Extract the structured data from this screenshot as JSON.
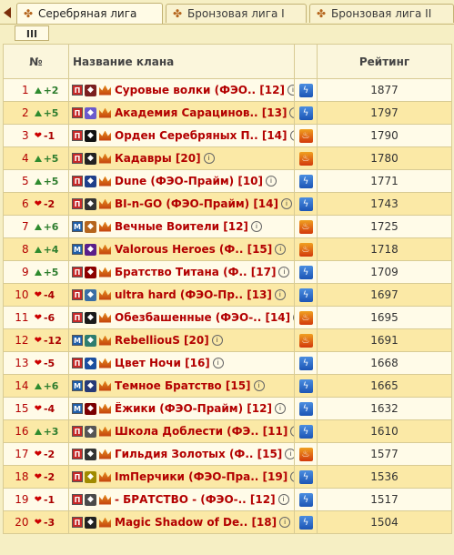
{
  "tabs": [
    {
      "label": "Серебряная лига",
      "active": true
    },
    {
      "label": "Бронзовая лига I",
      "active": false
    },
    {
      "label": "Бронзовая лига II",
      "active": false
    }
  ],
  "subtab": "III",
  "headers": {
    "num": "№",
    "name": "Название клана",
    "rating": "Рейтинг"
  },
  "rows": [
    {
      "rank": "1",
      "change": "+2",
      "dir": "up",
      "align": "П",
      "name": "Суровые волки (ФЭО.. [12]",
      "element": "water",
      "rating": "1877"
    },
    {
      "rank": "2",
      "change": "+5",
      "dir": "up",
      "align": "П",
      "name": "Академия Сарацинов.. [13]",
      "element": "water",
      "rating": "1797"
    },
    {
      "rank": "3",
      "change": "-1",
      "dir": "down",
      "align": "П",
      "name": "Орден Серебряных П.. [14]",
      "element": "fire",
      "rating": "1790"
    },
    {
      "rank": "4",
      "change": "+5",
      "dir": "up",
      "align": "П",
      "name": "Кадавры [20]",
      "element": "fire",
      "rating": "1780"
    },
    {
      "rank": "5",
      "change": "+5",
      "dir": "up",
      "align": "П",
      "name": "Dune (ФЭО-Прайм) [10]",
      "element": "water",
      "rating": "1771"
    },
    {
      "rank": "6",
      "change": "-2",
      "dir": "down",
      "align": "П",
      "name": "BI-n-GO (ФЭО-Прайм) [14]",
      "element": "water",
      "rating": "1743"
    },
    {
      "rank": "7",
      "change": "+6",
      "dir": "up",
      "align": "М",
      "name": "Вечные Воители [12]",
      "element": "fire",
      "rating": "1725"
    },
    {
      "rank": "8",
      "change": "+4",
      "dir": "up",
      "align": "М",
      "name": "Valorous Heroes (Ф.. [15]",
      "element": "fire",
      "rating": "1718"
    },
    {
      "rank": "9",
      "change": "+5",
      "dir": "up",
      "align": "П",
      "name": "Братство Титана (Ф.. [17]",
      "element": "water",
      "rating": "1709"
    },
    {
      "rank": "10",
      "change": "-4",
      "dir": "down",
      "align": "П",
      "name": "ultra hard (ФЭО-Пр.. [13]",
      "element": "water",
      "rating": "1697"
    },
    {
      "rank": "11",
      "change": "-6",
      "dir": "down",
      "align": "П",
      "name": "Обезбашенные (ФЭО-.. [14]",
      "element": "fire",
      "rating": "1695"
    },
    {
      "rank": "12",
      "change": "-12",
      "dir": "down",
      "align": "М",
      "name": "RebelliouS [20]",
      "element": "fire",
      "rating": "1691"
    },
    {
      "rank": "13",
      "change": "-5",
      "dir": "down",
      "align": "П",
      "name": "Цвет Ночи [16]",
      "element": "water",
      "rating": "1668"
    },
    {
      "rank": "14",
      "change": "+6",
      "dir": "up",
      "align": "М",
      "name": "Темное Братство [15]",
      "element": "water",
      "rating": "1665"
    },
    {
      "rank": "15",
      "change": "-4",
      "dir": "down",
      "align": "М",
      "name": "Ёжики (ФЭО-Прайм) [12]",
      "element": "water",
      "rating": "1632"
    },
    {
      "rank": "16",
      "change": "+3",
      "dir": "up",
      "align": "П",
      "name": "Школа Доблести (ФЭ.. [11]",
      "element": "water",
      "rating": "1610"
    },
    {
      "rank": "17",
      "change": "-2",
      "dir": "down",
      "align": "П",
      "name": "Гильдия Золотых (Ф.. [15]",
      "element": "fire",
      "rating": "1577"
    },
    {
      "rank": "18",
      "change": "-2",
      "dir": "down",
      "align": "П",
      "name": "ImПерчики (ФЭО-Пра.. [19]",
      "element": "water",
      "rating": "1536"
    },
    {
      "rank": "19",
      "change": "-1",
      "dir": "down",
      "align": "П",
      "name": "- БРАТСТВО - (ФЭО-.. [12]",
      "element": "water",
      "rating": "1517"
    },
    {
      "rank": "20",
      "change": "-3",
      "dir": "down",
      "align": "П",
      "name": "Magic Shadow of De.. [18]",
      "element": "water",
      "rating": "1504"
    }
  ],
  "icons": {
    "back": "back-arrow-icon",
    "tab": "league-emblem-icon",
    "rank_up": "arrow-up-icon",
    "rank_down": "heart-down-icon",
    "align": "alignment-badge-icon",
    "emblem": "clan-emblem-icon",
    "crown": "crown-icon",
    "info": "info-icon",
    "water": "water-element-icon",
    "fire": "fire-element-icon"
  },
  "colors": {
    "clan_name": "#b30000",
    "row_odd": "#fffbe8",
    "row_even": "#fbe9a6",
    "up": "#2e7d2e",
    "down": "#aa0000"
  }
}
